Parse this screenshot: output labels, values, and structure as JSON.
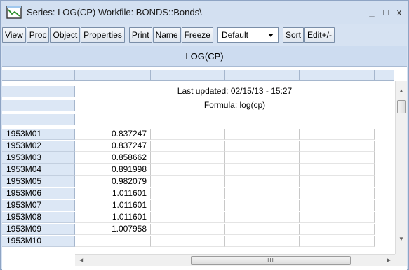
{
  "window": {
    "title": "Series: LOG(CP)   Workfile: BONDS::Bonds\\",
    "minimize_glyph": "_",
    "maximize_glyph": "□",
    "close_glyph": "x",
    "icon": "series-icon"
  },
  "toolbar": {
    "buttons": [
      "View",
      "Proc",
      "Object",
      "Properties",
      "Print",
      "Name",
      "Freeze"
    ],
    "dropdown_value": "Default",
    "sort_label": "Sort",
    "edit_label": "Edit+/-"
  },
  "sheet": {
    "object_title": "LOG(CP)",
    "last_updated": "Last updated: 02/15/13 - 15:27",
    "formula": "Formula: log(cp)",
    "rows": [
      {
        "label": "1953M01",
        "value": "0.837247"
      },
      {
        "label": "1953M02",
        "value": "0.837247"
      },
      {
        "label": "1953M03",
        "value": "0.858662"
      },
      {
        "label": "1953M04",
        "value": "0.891998"
      },
      {
        "label": "1953M05",
        "value": "0.982079"
      },
      {
        "label": "1953M06",
        "value": "1.011601"
      },
      {
        "label": "1953M07",
        "value": "1.011601"
      },
      {
        "label": "1953M08",
        "value": "1.011601"
      },
      {
        "label": "1953M09",
        "value": "1.007958"
      },
      {
        "label": "1953M10",
        "value": ""
      }
    ]
  },
  "scrollbars": {
    "vertical_up": "▲",
    "vertical_down": "▼",
    "horizontal_left": "◀",
    "horizontal_right": "▶",
    "thumb_grip": "III"
  },
  "colors": {
    "titlebar": "#d3e0f1",
    "header_cells": "#dce7f5",
    "object_title_bar": "#cddcf0"
  }
}
